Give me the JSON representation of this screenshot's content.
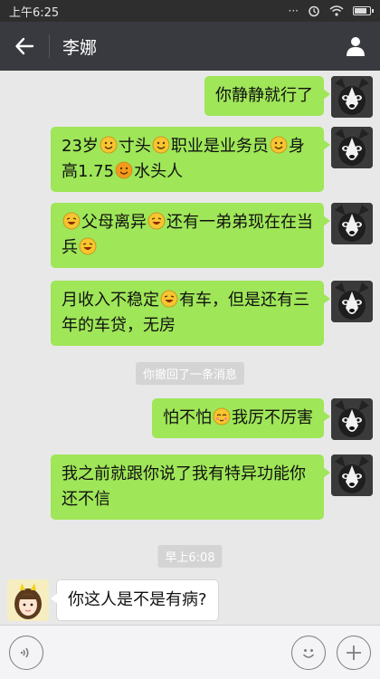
{
  "status_bar": {
    "time": "上午6:25",
    "icons": [
      "dots-icon",
      "alarm-icon",
      "wifi-icon",
      "battery-icon"
    ]
  },
  "header": {
    "title": "李娜",
    "back_icon": "back-arrow-icon",
    "profile_icon": "person-icon"
  },
  "messages": [
    {
      "side": "right",
      "segments": [
        {
          "t": "text",
          "v": "你静静就行了"
        }
      ]
    },
    {
      "side": "right",
      "segments": [
        {
          "t": "text",
          "v": "23岁"
        },
        {
          "t": "emoji",
          "v": "smile"
        },
        {
          "t": "text",
          "v": "寸头"
        },
        {
          "t": "emoji",
          "v": "smile"
        },
        {
          "t": "text",
          "v": "职业是业务员"
        },
        {
          "t": "emoji",
          "v": "smile"
        },
        {
          "t": "text",
          "v": "身高1.75"
        },
        {
          "t": "emoji",
          "v": "orange"
        },
        {
          "t": "text",
          "v": "水头人"
        }
      ]
    },
    {
      "side": "right",
      "segments": [
        {
          "t": "emoji",
          "v": "laugh"
        },
        {
          "t": "text",
          "v": "父母离异"
        },
        {
          "t": "emoji",
          "v": "laugh"
        },
        {
          "t": "text",
          "v": "还有一弟弟现在在当兵"
        },
        {
          "t": "emoji",
          "v": "laugh"
        }
      ]
    },
    {
      "side": "right",
      "segments": [
        {
          "t": "text",
          "v": "月收入不稳定"
        },
        {
          "t": "emoji",
          "v": "laugh"
        },
        {
          "t": "text",
          "v": "有车，但是还有三年的车贷，无房"
        }
      ]
    },
    {
      "side": "system",
      "text": "你撤回了一条消息"
    },
    {
      "side": "right",
      "segments": [
        {
          "t": "text",
          "v": "怕不怕"
        },
        {
          "t": "emoji",
          "v": "shy"
        },
        {
          "t": "text",
          "v": "我厉不厉害"
        }
      ]
    },
    {
      "side": "right",
      "segments": [
        {
          "t": "text",
          "v": "我之前就跟你说了我有特异功能你还不信"
        }
      ]
    },
    {
      "side": "system",
      "text": "早上6:08"
    },
    {
      "side": "left",
      "segments": [
        {
          "t": "text",
          "v": "你这人是不是有病?"
        }
      ]
    }
  ],
  "input_bar": {
    "voice_icon": "voice-icon",
    "emoji_icon": "emoji-icon",
    "plus_icon": "plus-icon"
  },
  "colors": {
    "bubble_self": "#9fe658",
    "title_bar": "#393a3f",
    "background": "#e8e8e8"
  }
}
